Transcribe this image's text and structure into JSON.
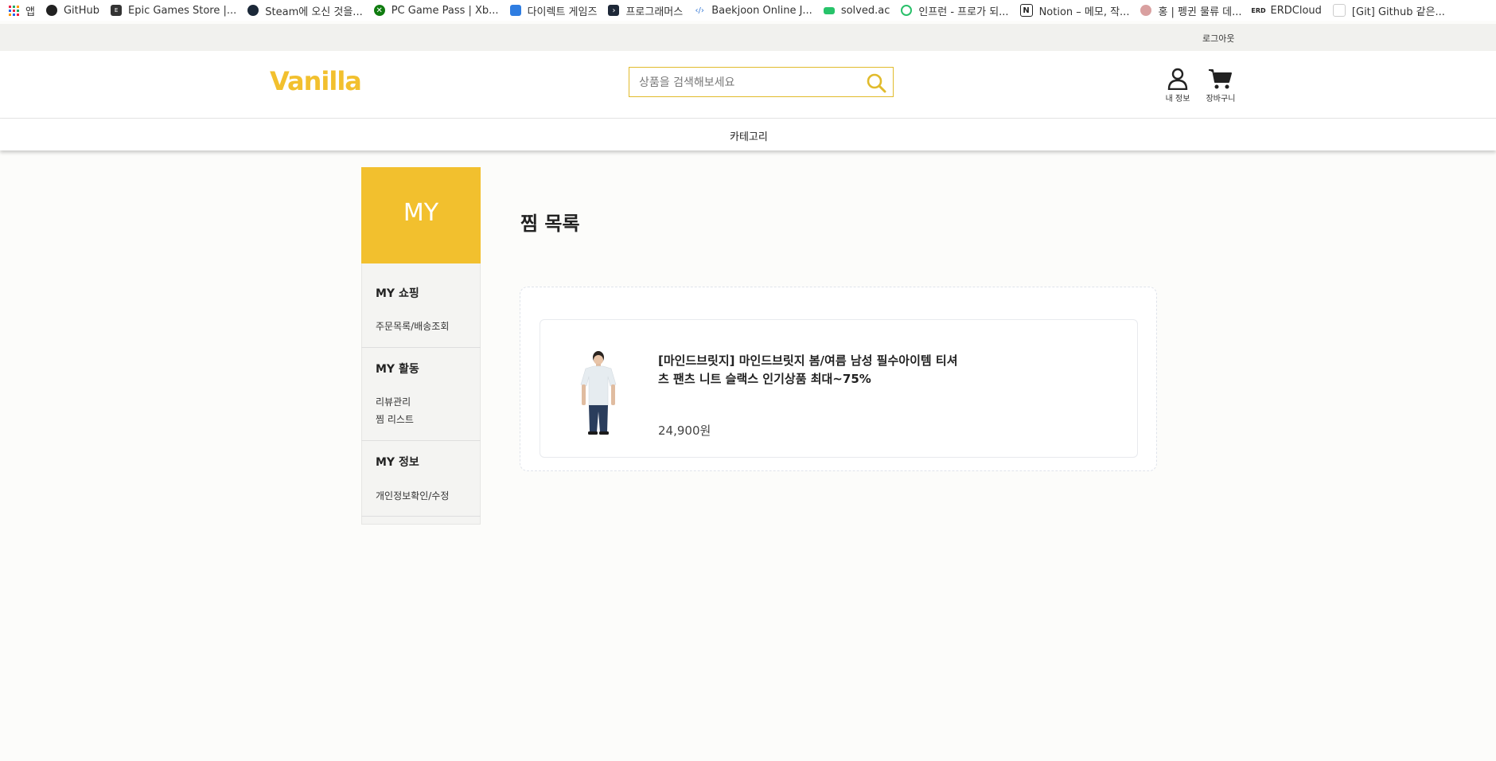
{
  "bookmarks": [
    {
      "label": "앱",
      "icon": "apps-grid-icon"
    },
    {
      "label": "GitHub",
      "icon": "github-icon"
    },
    {
      "label": "Epic Games Store |...",
      "icon": "epic-games-icon"
    },
    {
      "label": "Steam에 오신 것을...",
      "icon": "steam-icon"
    },
    {
      "label": "PC Game Pass | Xb...",
      "icon": "xbox-icon"
    },
    {
      "label": "다이렉트 게임즈",
      "icon": "direct-games-icon"
    },
    {
      "label": "프로그래머스",
      "icon": "programmers-icon"
    },
    {
      "label": "Baekjoon Online J...",
      "icon": "baekjoon-icon"
    },
    {
      "label": "solved.ac",
      "icon": "solved-ac-icon"
    },
    {
      "label": "인프런 - 프로가 되...",
      "icon": "inflearn-icon"
    },
    {
      "label": "Notion – 메모, 작...",
      "icon": "notion-icon"
    },
    {
      "label": "홍 | 펭귄 물류 데...",
      "icon": "penguin-icon"
    },
    {
      "label": "ERDCloud",
      "icon": "erdcloud-icon"
    },
    {
      "label": "[Git] Github 같은...",
      "icon": "page-icon"
    }
  ],
  "top": {
    "logout": "로그아웃"
  },
  "header": {
    "logo": "Vanilla",
    "search_placeholder": "상품을 검색해보세요",
    "my_info": "내 정보",
    "cart": "장바구니"
  },
  "nav": {
    "category": "카테고리"
  },
  "sidebar": {
    "title": "MY",
    "sections": [
      {
        "title": "MY 쇼핑",
        "links": [
          "주문목록/배송조회"
        ]
      },
      {
        "title": "MY 활동",
        "links": [
          "리뷰관리",
          "찜 리스트"
        ]
      },
      {
        "title": "MY 정보",
        "links": [
          "개인정보확인/수정"
        ]
      }
    ]
  },
  "main": {
    "title": "찜 목록",
    "items": [
      {
        "name_line1": "[마인드브릿지] 마인드브릿지 봄/여름 남성 필수아이템 티셔",
        "name_line2": "츠 팬츠 니트 슬랙스 인기상품 최대~75%",
        "price": "24,900원"
      }
    ]
  },
  "colors": {
    "accent": "#f2c02e",
    "background": "#fcfcfa"
  }
}
